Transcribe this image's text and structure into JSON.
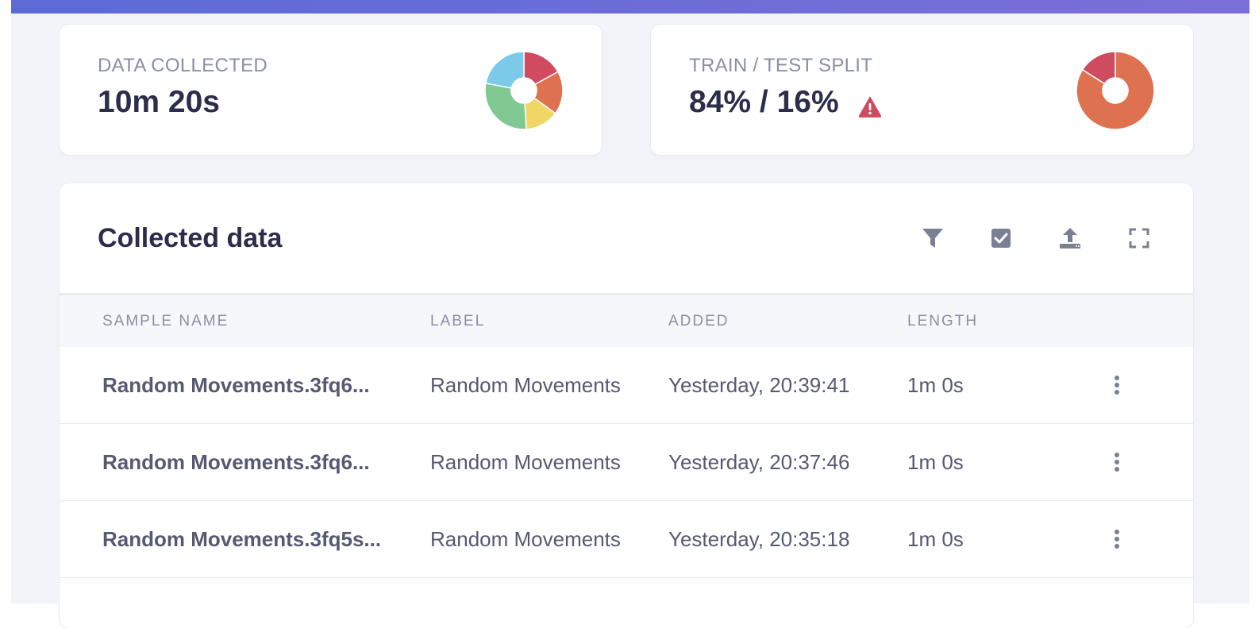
{
  "colors": {
    "top_bar_start": "#5c6bd6",
    "top_bar_end": "#7b6fd8",
    "accent_red": "#cf4b5f",
    "accent_orange": "#de7150",
    "accent_yellow": "#f0d764",
    "accent_green": "#7fc993",
    "accent_blue": "#7ccae9"
  },
  "stats": [
    {
      "label": "DATA COLLECTED",
      "value": "10m 20s",
      "pie_icon": "data-collected-pie",
      "slices": [
        {
          "label": "red",
          "value": 17,
          "color": "#d04b5f"
        },
        {
          "label": "orange",
          "value": 18,
          "color": "#de7150"
        },
        {
          "label": "yellow",
          "value": 14,
          "color": "#f2d665"
        },
        {
          "label": "green",
          "value": 29,
          "color": "#80c993"
        },
        {
          "label": "blue",
          "value": 22,
          "color": "#7ccae9"
        }
      ]
    },
    {
      "label": "TRAIN / TEST SPLIT",
      "value": "84% / 16%",
      "warning_icon": "warning-triangle-icon",
      "slices": [
        {
          "label": "train",
          "value": 84,
          "color": "#de7150"
        },
        {
          "label": "test",
          "value": 16,
          "color": "#cf4b5f"
        }
      ]
    }
  ],
  "collected": {
    "title": "Collected data",
    "toolbar": [
      {
        "name": "filter-icon"
      },
      {
        "name": "checkbox-select-icon"
      },
      {
        "name": "upload-icon"
      },
      {
        "name": "fullscreen-icon"
      }
    ],
    "columns": [
      "SAMPLE NAME",
      "LABEL",
      "ADDED",
      "LENGTH"
    ],
    "rows": [
      {
        "name": "Random Movements.3fq6...",
        "label": "Random Movements",
        "added": "Yesterday, 20:39:41",
        "length": "1m 0s"
      },
      {
        "name": "Random Movements.3fq6...",
        "label": "Random Movements",
        "added": "Yesterday, 20:37:46",
        "length": "1m 0s"
      },
      {
        "name": "Random Movements.3fq5s...",
        "label": "Random Movements",
        "added": "Yesterday, 20:35:18",
        "length": "1m 0s"
      }
    ]
  }
}
